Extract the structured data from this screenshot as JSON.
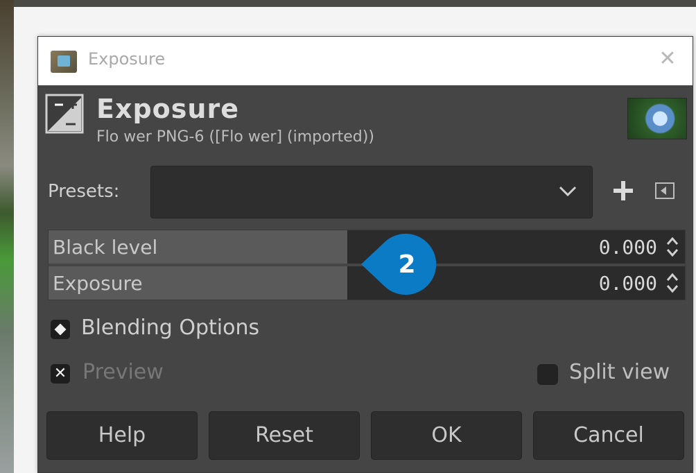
{
  "window": {
    "title": "Exposure",
    "close_icon": "close-icon"
  },
  "header": {
    "heading": "Exposure",
    "subtitle": "Flo wer PNG-6 ([Flo wer] (imported))",
    "tool_icon": "exposure-tool-icon",
    "thumbnail_icon": "image-thumbnail"
  },
  "presets": {
    "label": "Presets:",
    "value": "",
    "add_icon": "plus-icon",
    "menu_icon": "menu-icon"
  },
  "sliders": [
    {
      "label": "Black level",
      "value": "0.000",
      "fill_fraction": 0.47
    },
    {
      "label": "Exposure",
      "value": "0.000",
      "fill_fraction": 0.47
    }
  ],
  "callout": {
    "number": "2",
    "color": "#0c7bc6"
  },
  "blending": {
    "label": "Blending Options"
  },
  "preview": {
    "label": "Preview",
    "checked": true
  },
  "split_view": {
    "label": "Split view",
    "checked": false
  },
  "buttons": {
    "help": "Help",
    "reset": "Reset",
    "ok": "OK",
    "cancel": "Cancel"
  }
}
